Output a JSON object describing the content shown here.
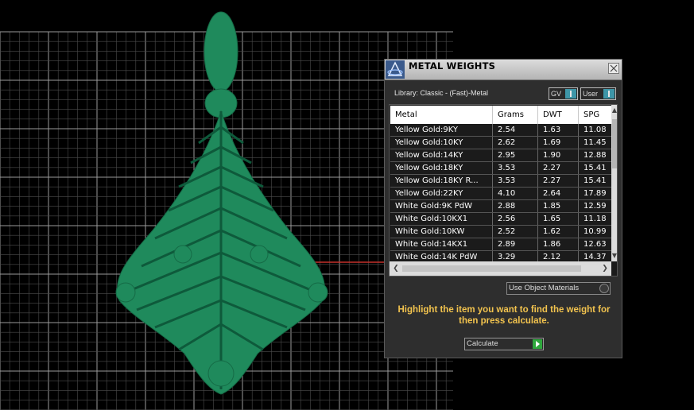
{
  "viewport": {
    "background": "#000000",
    "grid_color": "#7a7a7a",
    "axis_color": "#c4302b",
    "model_color": "#1f8a5c"
  },
  "dialog": {
    "title": "METAL WEIGHTS",
    "library_label": "Library: Classic - (Fast)-Metal",
    "toggle_gv": "GV",
    "toggle_user": "User",
    "table": {
      "columns": [
        "Metal",
        "Grams",
        "DWT",
        "SPG"
      ],
      "rows": [
        [
          "Yellow Gold:9KY",
          "2.54",
          "1.63",
          "11.08"
        ],
        [
          "Yellow Gold:10KY",
          "2.62",
          "1.69",
          "11.45"
        ],
        [
          "Yellow Gold:14KY",
          "2.95",
          "1.90",
          "12.88"
        ],
        [
          "Yellow Gold:18KY",
          "3.53",
          "2.27",
          "15.41"
        ],
        [
          "Yellow Gold:18KY R...",
          "3.53",
          "2.27",
          "15.41"
        ],
        [
          "Yellow Gold:22KY",
          "4.10",
          "2.64",
          "17.89"
        ],
        [
          "White Gold:9K PdW",
          "2.88",
          "1.85",
          "12.59"
        ],
        [
          "White Gold:10KX1",
          "2.56",
          "1.65",
          "11.18"
        ],
        [
          "White Gold:10KW",
          "2.52",
          "1.62",
          "10.99"
        ],
        [
          "White Gold:14KX1",
          "2.89",
          "1.86",
          "12.63"
        ],
        [
          "White Gold:14K PdW",
          "3.29",
          "2.12",
          "14.37"
        ]
      ]
    },
    "materials_dropdown": "Use Object Materials",
    "instruction": "Highlight the item you want to find the weight for then press calculate.",
    "calculate_label": "Calculate",
    "accent_color": "#f2c34e",
    "toggle_color": "#3e96a8",
    "go_color": "#2fa83d"
  }
}
